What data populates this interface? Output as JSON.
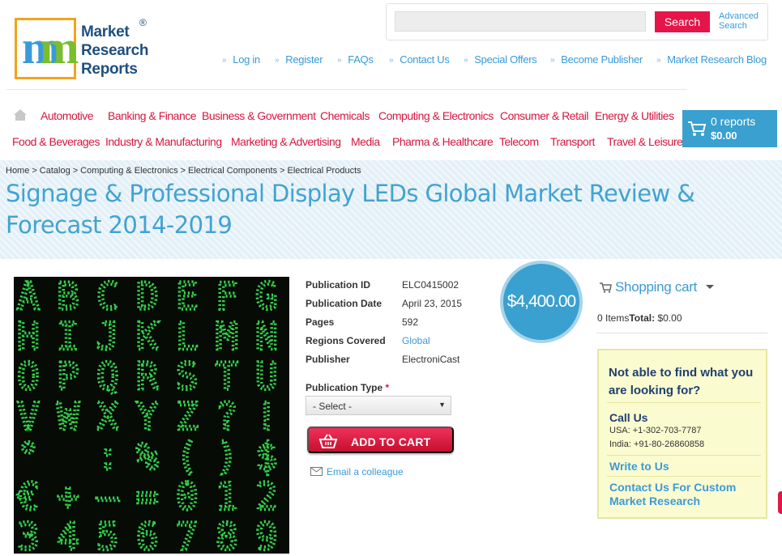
{
  "logo": {
    "line1": "Market",
    "line2": "Research",
    "line3": "Reports",
    "mark": "m",
    "registered": "®"
  },
  "search": {
    "value": "",
    "placeholder": "",
    "button": "Search",
    "advanced_line1": "Advanced",
    "advanced_line2": "Search"
  },
  "toplinks": [
    "Log in",
    "Register",
    "FAQs",
    "Contact Us",
    "Special Offers",
    "Become Publisher",
    "Market Research Blog"
  ],
  "categories_row1": [
    "Automotive",
    "Banking & Finance",
    "Business & Government",
    "Chemicals",
    "Computing & Electronics",
    "Consumer & Retail",
    "Energy & Utilities"
  ],
  "categories_row2": [
    "Food & Beverages",
    "Industry & Manufacturing",
    "Marketing & Advertising",
    "Media",
    "Pharma & Healthcare",
    "Telecom",
    "Transport",
    "Travel & Leisure"
  ],
  "cart": {
    "reports": "0 reports",
    "amount": "$0.00"
  },
  "breadcrumb": [
    "Home",
    "Catalog",
    "Computing & Electronics",
    "Electrical Components",
    "Electrical Products"
  ],
  "page_title": "Signage & Professional Display LEDs Global Market Review & Forecast 2014-2019",
  "product_image": {
    "rows": [
      "ABCDEFG",
      "HIJKLMN",
      "OPQRSTU",
      "VWXYZ?!",
      "° :%()$",
      "€+–=012",
      "3456789"
    ]
  },
  "details": [
    {
      "label": "Publication ID",
      "value": "ELC0415002"
    },
    {
      "label": "Publication Date",
      "value": "April 23, 2015"
    },
    {
      "label": "Pages",
      "value": "592"
    },
    {
      "label": "Regions Covered",
      "value": "Global"
    },
    {
      "label": "Publisher",
      "value": "ElectroniCast"
    }
  ],
  "price": "$4,400.00",
  "publication_type": {
    "label": "Publication Type",
    "required_mark": "*",
    "selected": "- Select -"
  },
  "add_to_cart": "ADD TO CART",
  "email_colleague": "Email a colleague",
  "shopping_cart": {
    "title": "Shopping cart",
    "items": "0 Items",
    "total_label": "Total:",
    "total_value": " $0.00"
  },
  "help": {
    "title": "Not able to find what you are looking for?",
    "call_us": "Call Us",
    "usa": "USA: +1-302-703-7787",
    "india": "India: +91-80-26860858",
    "write_to_us": "Write to Us",
    "custom_research": "Contact Us For Custom Market Research"
  },
  "colors": {
    "brand_blue": "#39a0cf",
    "accent_red": "#e5154a",
    "title_blue": "#42a3d1",
    "led_green": "#33d14a"
  }
}
